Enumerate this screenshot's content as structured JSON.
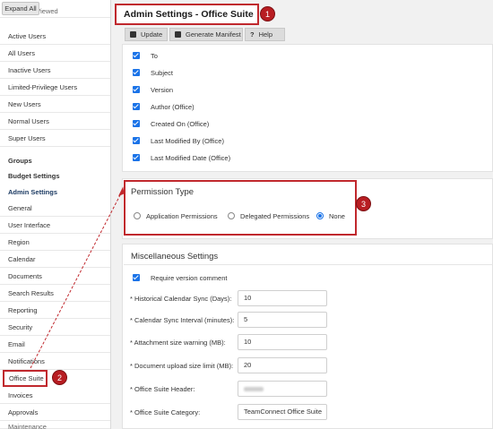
{
  "sidebar": {
    "expand_all": "Expand All",
    "partial_top": "Recently Viewed",
    "items_users": [
      "Active Users",
      "All Users",
      "Inactive Users",
      "Limited-Privilege Users",
      "New Users",
      "Normal Users",
      "Super Users"
    ],
    "groups": "Groups",
    "budget_settings": "Budget Settings",
    "admin_settings": "Admin Settings",
    "items_admin": [
      "General",
      "User Interface",
      "Region",
      "Calendar",
      "Documents",
      "Search Results",
      "Reporting",
      "Security",
      "Email",
      "Notifications"
    ],
    "office_suite": "Office Suite",
    "items_after": [
      "Invoices",
      "Approvals"
    ],
    "partial_bottom": "Maintenance"
  },
  "header": {
    "title": "Admin Settings - Office Suite"
  },
  "toolbar": {
    "update": "Update",
    "generate_manifest": "Generate Manifest",
    "help_icon": "?",
    "help": "Help"
  },
  "fields": {
    "items": [
      "To",
      "Subject",
      "Version",
      "Author (Office)",
      "Created On (Office)",
      "Last Modified By (Office)",
      "Last Modified Date (Office)"
    ]
  },
  "permission": {
    "title": "Permission Type",
    "options": [
      "Application Permissions",
      "Delegated Permissions",
      "None"
    ],
    "selected": "None"
  },
  "misc": {
    "title": "Miscellaneous Settings",
    "require_version_comment": "Require version comment",
    "historical_label": "* Historical Calendar Sync (Days):",
    "historical_value": "10",
    "interval_label": "* Calendar Sync Interval (minutes):",
    "interval_value": "5",
    "attachment_label": "* Attachment size warning (MB):",
    "attachment_value": "10",
    "upload_label": "* Document upload size limit (MB):",
    "upload_value": "20",
    "header_label": "* Office Suite Header:",
    "category_label": "* Office Suite Category:",
    "category_value": "TeamConnect Office Suite"
  },
  "callouts": {
    "one": "1",
    "two": "2",
    "three": "3"
  },
  "colors": {
    "accent": "#1a73e8",
    "highlight": "#c0282d",
    "badge": "#b81d22"
  }
}
